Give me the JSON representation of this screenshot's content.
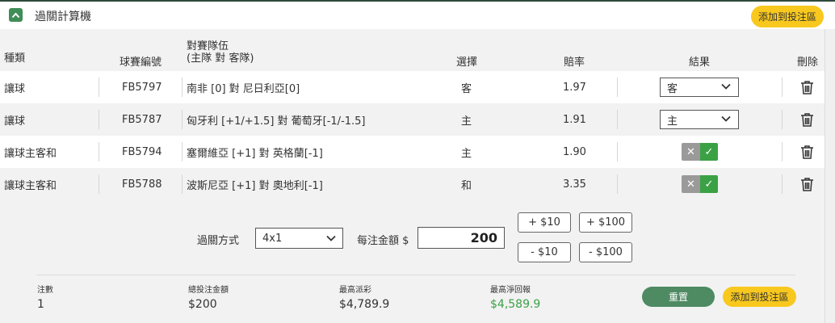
{
  "header": {
    "title": "過關計算機",
    "add_button": "添加到投注區"
  },
  "table": {
    "columns": {
      "type": "種類",
      "match_no": "球賽編號",
      "teams_line1": "對賽隊伍",
      "teams_line2": "(主隊 對 客隊)",
      "selection": "選擇",
      "odds": "賠率",
      "result": "結果",
      "delete": "刪除"
    },
    "rows": [
      {
        "type": "讓球",
        "match_no": "FB5797",
        "teams": "南非 [0] 對 尼日利亞[0]",
        "selection": "客",
        "odds": "1.97",
        "result_kind": "dropdown",
        "result_value": "客"
      },
      {
        "type": "讓球",
        "match_no": "FB5787",
        "teams": "匈牙利 [+1/+1.5] 對 葡萄牙[-1/-1.5]",
        "selection": "主",
        "odds": "1.91",
        "result_kind": "dropdown",
        "result_value": "主"
      },
      {
        "type": "讓球主客和",
        "match_no": "FB5794",
        "teams": "塞爾維亞 [+1] 對 英格蘭[-1]",
        "selection": "主",
        "odds": "1.90",
        "result_kind": "toggle",
        "result_value": ""
      },
      {
        "type": "讓球主客和",
        "match_no": "FB5788",
        "teams": "波斯尼亞 [+1] 對 奧地利[-1]",
        "selection": "和",
        "odds": "3.35",
        "result_kind": "toggle",
        "result_value": ""
      }
    ]
  },
  "controls": {
    "method_label": "過關方式",
    "method_value": "4x1",
    "amount_label": "每注金額 $",
    "amount_value": "200",
    "plus10": "+ $10",
    "plus100": "+ $100",
    "minus10": "- $10",
    "minus100": "- $100"
  },
  "summary": {
    "count_label": "注數",
    "count_value": "1",
    "total_label": "總投注金額",
    "total_value": "$200",
    "max_payout_label": "最高派彩",
    "max_payout_value": "$4,789.9",
    "max_net_label": "最高淨回報",
    "max_net_value": "$4,589.9",
    "reset_button": "重置",
    "add_button": "添加到投注區"
  },
  "colors": {
    "accent_green": "#3f8d57",
    "yellow": "#f8c81e",
    "positive": "#3ba145"
  }
}
